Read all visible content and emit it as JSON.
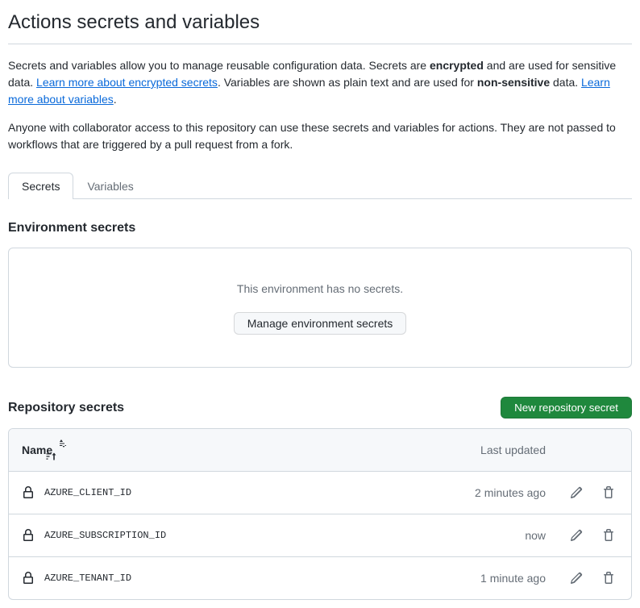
{
  "page": {
    "title": "Actions secrets and variables",
    "intro1_a": "Secrets and variables allow you to manage reusable configuration data. Secrets are ",
    "intro1_b": "encrypted",
    "intro1_c": " and are used for sensitive data. ",
    "intro1_link1": "Learn more about encrypted secrets",
    "intro1_d": ". Variables are shown as plain text and are used for ",
    "intro1_e": "non-sensitive",
    "intro1_f": " data. ",
    "intro1_link2": "Learn more about variables",
    "intro1_g": ".",
    "intro2": "Anyone with collaborator access to this repository can use these secrets and variables for actions. They are not passed to workflows that are triggered by a pull request from a fork."
  },
  "tabs": {
    "secrets": "Secrets",
    "variables": "Variables"
  },
  "env_secrets": {
    "heading": "Environment secrets",
    "empty_text": "This environment has no secrets.",
    "manage_button": "Manage environment secrets"
  },
  "repo_secrets": {
    "heading": "Repository secrets",
    "new_button": "New repository secret",
    "col_name": "Name",
    "col_updated": "Last updated",
    "rows": [
      {
        "name": "AZURE_CLIENT_ID",
        "updated": "2 minutes ago"
      },
      {
        "name": "AZURE_SUBSCRIPTION_ID",
        "updated": "now"
      },
      {
        "name": "AZURE_TENANT_ID",
        "updated": "1 minute ago"
      }
    ]
  }
}
